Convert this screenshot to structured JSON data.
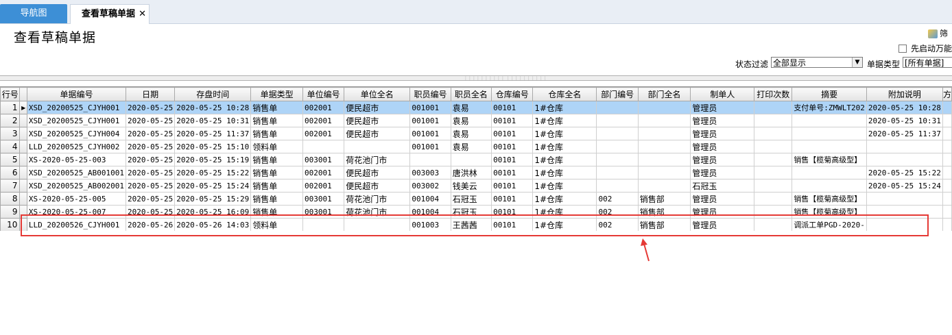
{
  "tabs": [
    {
      "label": "导航图"
    },
    {
      "label": "查看草稿单据",
      "close": "✕"
    }
  ],
  "page_title": "查看草稿单据",
  "toolbar": {
    "filter_label": "筛",
    "checkbox_label": "先启动万能",
    "status_filter_label": "状态过滤",
    "status_filter_value": "全部显示",
    "bill_type_label": "单据类型",
    "bill_type_value": "[所有单据]"
  },
  "table": {
    "columns": [
      "行号",
      "",
      "单据编号",
      "日期",
      "存盘时间",
      "单据类型",
      "单位编号",
      "单位全名",
      "职员编号",
      "职员全名",
      "仓库编号",
      "仓库全名",
      "部门编号",
      "部门全名",
      "制单人",
      "打印次数",
      "摘要",
      "附加说明",
      "方"
    ],
    "rows": [
      [
        "1",
        "▶",
        "XSD_20200525_CJYH001",
        "2020-05-25",
        "2020-05-25 10:28",
        "销售单",
        "002001",
        "便民超市",
        "001001",
        "袁易",
        "00101",
        "1#仓库",
        "",
        "",
        "管理员",
        "",
        "支付单号:ZMWLT202",
        "2020-05-25 10:28"
      ],
      [
        "2",
        "",
        "XSD_20200525_CJYH001",
        "2020-05-25",
        "2020-05-25 10:31",
        "销售单",
        "002001",
        "便民超市",
        "001001",
        "袁易",
        "00101",
        "1#仓库",
        "",
        "",
        "管理员",
        "",
        "",
        "2020-05-25 10:31"
      ],
      [
        "3",
        "",
        "XSD_20200525_CJYH004",
        "2020-05-25",
        "2020-05-25 11:37",
        "销售单",
        "002001",
        "便民超市",
        "001001",
        "袁易",
        "00101",
        "1#仓库",
        "",
        "",
        "管理员",
        "",
        "",
        "2020-05-25 11:37"
      ],
      [
        "4",
        "",
        "LLD_20200525_CJYH002",
        "2020-05-25",
        "2020-05-25 15:10",
        "领料单",
        "",
        "",
        "001001",
        "袁易",
        "00101",
        "1#仓库",
        "",
        "",
        "管理员",
        "",
        "",
        ""
      ],
      [
        "5",
        "",
        "XS-2020-05-25-003",
        "2020-05-25",
        "2020-05-25 15:19",
        "销售单",
        "003001",
        "荷花池门市",
        "",
        "",
        "00101",
        "1#仓库",
        "",
        "",
        "管理员",
        "",
        "销售【榄菊高级型】",
        ""
      ],
      [
        "6",
        "",
        "XSD_20200525_AB001001",
        "2020-05-25",
        "2020-05-25 15:22",
        "销售单",
        "002001",
        "便民超市",
        "003003",
        "唐洪林",
        "00101",
        "1#仓库",
        "",
        "",
        "管理员",
        "",
        "",
        "2020-05-25 15:22"
      ],
      [
        "7",
        "",
        "XSD_20200525_AB002001",
        "2020-05-25",
        "2020-05-25 15:24",
        "销售单",
        "002001",
        "便民超市",
        "003002",
        "钱美云",
        "00101",
        "1#仓库",
        "",
        "",
        "石冠玉",
        "",
        "",
        "2020-05-25 15:24"
      ],
      [
        "8",
        "",
        "XS-2020-05-25-005",
        "2020-05-25",
        "2020-05-25 15:29",
        "销售单",
        "003001",
        "荷花池门市",
        "001004",
        "石冠玉",
        "00101",
        "1#仓库",
        "002",
        "销售部",
        "管理员",
        "",
        "销售【榄菊高级型】",
        ""
      ],
      [
        "9",
        "",
        "XS-2020-05-25-007",
        "2020-05-25",
        "2020-05-25 16:09",
        "销售单",
        "003001",
        "荷花池门市",
        "001004",
        "石冠玉",
        "00101",
        "1#仓库",
        "002",
        "销售部",
        "管理员",
        "",
        "销售【榄菊高级型】",
        ""
      ],
      [
        "10",
        "",
        "LLD_20200526_CJYH001",
        "2020-05-26",
        "2020-05-26 14:03",
        "领料单",
        "",
        "",
        "001003",
        "王茜茜",
        "00101",
        "1#仓库",
        "002",
        "销售部",
        "管理员",
        "",
        "调派工单PGD-2020-",
        ""
      ]
    ]
  }
}
